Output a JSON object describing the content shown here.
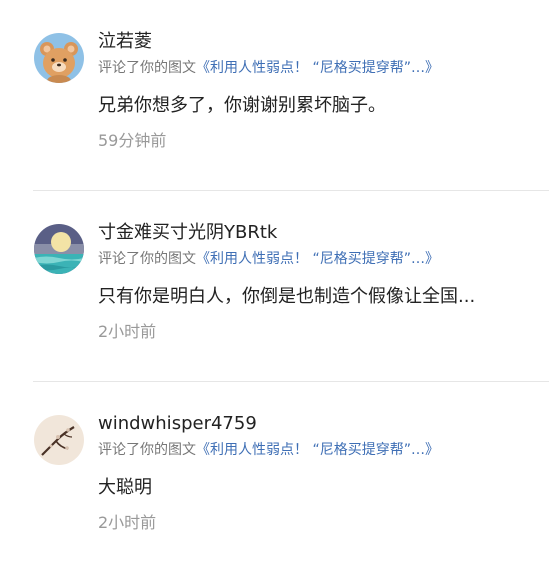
{
  "notifications": [
    {
      "username": "泣若菱",
      "action_prefix": "评论了你的图文",
      "open_quote": "《",
      "article_title": "利用人性弱点！ “尼格买提穿帮”…",
      "close_quote": "》",
      "comment": "兄弟你想多了，你谢谢别累坏脑子。",
      "time": "59分钟前",
      "avatar_icon": "bear-avatar-icon"
    },
    {
      "username": "寸金难买寸光阴YBRtk",
      "action_prefix": "评论了你的图文",
      "open_quote": "《",
      "article_title": "利用人性弱点！ “尼格买提穿帮”…",
      "close_quote": "》",
      "comment": "只有你是明白人，你倒是也制造个假像让全国...",
      "time": "2小时前",
      "avatar_icon": "moon-sea-avatar-icon"
    },
    {
      "username": "windwhisper4759",
      "action_prefix": "评论了你的图文",
      "open_quote": "《",
      "article_title": "利用人性弱点！ “尼格买提穿帮”…",
      "close_quote": "》",
      "comment": "大聪明",
      "time": "2小时前",
      "avatar_icon": "plum-branch-avatar-icon"
    }
  ],
  "colors": {
    "link": "#3f6fb5",
    "meta": "#777777",
    "time": "#999999",
    "divider": "#e6e6e6"
  }
}
